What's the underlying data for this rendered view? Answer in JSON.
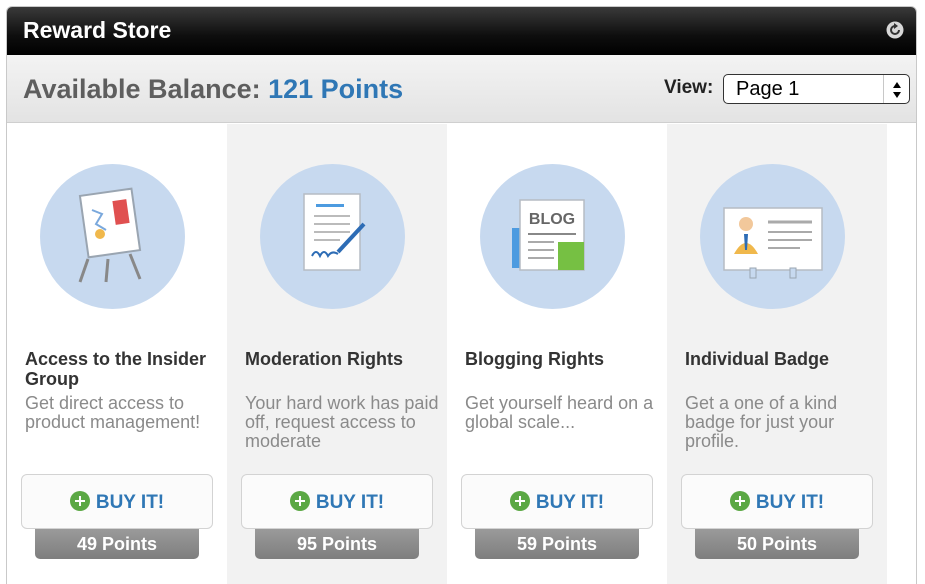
{
  "widget": {
    "title": "Reward Store",
    "refresh_icon": "refresh-icon"
  },
  "balance": {
    "label": "Available Balance:",
    "value": "121 Points",
    "value_color": "#2f77b5"
  },
  "view": {
    "label": "View:",
    "selected": "Page 1"
  },
  "items": [
    {
      "title": "Access to the Insider Group",
      "description": "Get direct access to product management!",
      "button_label": "BUY IT!",
      "price": "49 Points",
      "icon": "presentation-board-icon"
    },
    {
      "title": "Moderation Rights",
      "description": "Your hard work has paid off, request access to moderate",
      "button_label": "BUY IT!",
      "price": "95 Points",
      "icon": "document-signature-icon"
    },
    {
      "title": "Blogging Rights",
      "description": "Get yourself heard on a global scale...",
      "button_label": "BUY IT!",
      "price": "59 Points",
      "icon": "blog-newspaper-icon"
    },
    {
      "title": "Individual Badge",
      "description": "Get a one of a kind badge for just your profile.",
      "button_label": "BUY IT!",
      "price": "50 Points",
      "icon": "id-badge-icon"
    }
  ],
  "colors": {
    "accent": "#2f77b5",
    "plus_green": "#5ba844",
    "circle": "#c7d9ef"
  }
}
